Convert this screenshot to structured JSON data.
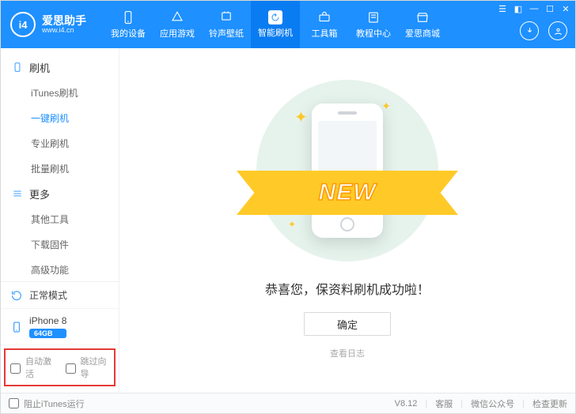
{
  "brand": {
    "logo_text": "i4",
    "title": "爱思助手",
    "subtitle": "www.i4.cn"
  },
  "topnav": [
    {
      "label": "我的设备",
      "icon": "device"
    },
    {
      "label": "应用游戏",
      "icon": "apps"
    },
    {
      "label": "铃声壁纸",
      "icon": "music"
    },
    {
      "label": "智能刷机",
      "icon": "flash"
    },
    {
      "label": "工具箱",
      "icon": "toolbox"
    },
    {
      "label": "教程中心",
      "icon": "book"
    },
    {
      "label": "爱思商城",
      "icon": "shop"
    }
  ],
  "topnav_active_index": 3,
  "sidebar": {
    "categories": [
      {
        "title": "刷机",
        "icon": "phone",
        "items": [
          "iTunes刷机",
          "一键刷机",
          "专业刷机",
          "批量刷机"
        ],
        "active_item_index": 1
      },
      {
        "title": "更多",
        "icon": "more",
        "items": [
          "其他工具",
          "下载固件",
          "高级功能"
        ],
        "active_item_index": -1
      }
    ],
    "mode": {
      "label": "正常模式"
    },
    "device": {
      "name": "iPhone 8",
      "storage": "64GB"
    },
    "checks": [
      "自动激活",
      "跳过向导"
    ]
  },
  "content": {
    "ribbon": "NEW",
    "success_text": "恭喜您，保资料刷机成功啦！",
    "ok_button": "确定",
    "view_log": "查看日志"
  },
  "statusbar": {
    "block_itunes": "阻止iTunes运行",
    "version": "V8.12",
    "links": [
      "客服",
      "微信公众号",
      "检查更新"
    ]
  }
}
